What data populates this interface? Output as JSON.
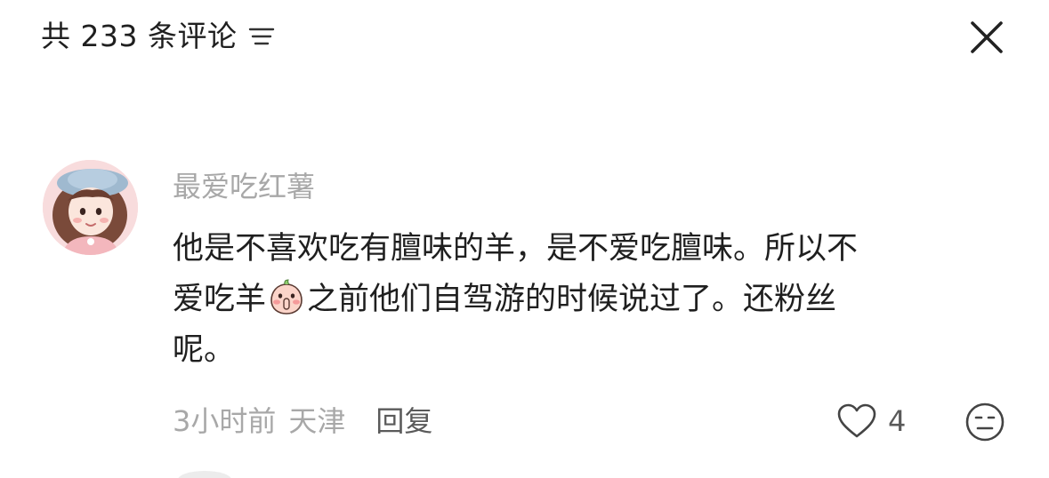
{
  "header": {
    "title": "共 233 条评论",
    "filter_icon": "filter-lines-icon",
    "close_icon": "close-icon"
  },
  "comment": {
    "username": "最爱吃红薯",
    "avatar_icon": "user-avatar",
    "text_lines": {
      "line1": "他是不喜欢吃有膻味的羊，是不爱吃膻味。所以不",
      "line2_before": "爱吃羊",
      "line2_emoji": "shush-face-emoji",
      "line2_after": "之前他们自驾游的时候说过了。还粉丝",
      "line3": "呢。"
    },
    "time": "3小时前",
    "location": "天津",
    "reply_label": "回复",
    "like_icon": "heart-outline-icon",
    "like_count": "4",
    "dislike_icon": "unamused-face-icon"
  },
  "colors": {
    "text_primary": "#1f1f1f",
    "text_secondary": "#a8a8a8",
    "text_action": "#5a5a5a",
    "avatar_bg": "#f6d7d8"
  }
}
